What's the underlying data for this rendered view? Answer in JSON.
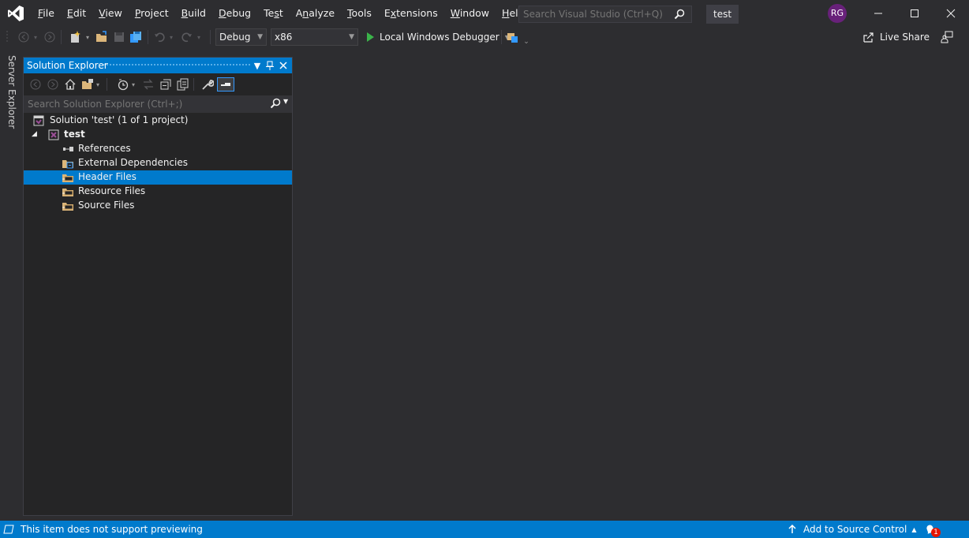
{
  "menu": {
    "items": [
      {
        "u": "F",
        "rest": "ile"
      },
      {
        "u": "E",
        "rest": "dit"
      },
      {
        "u": "V",
        "rest": "iew"
      },
      {
        "u": "P",
        "rest": "roject"
      },
      {
        "u": "B",
        "rest": "uild"
      },
      {
        "u": "D",
        "rest": "ebug"
      },
      {
        "u": "",
        "rest": "Te",
        "u2": "s",
        "rest2": "t"
      },
      {
        "u": "",
        "rest": "A",
        "u2": "n",
        "rest2": "alyze"
      },
      {
        "u": "T",
        "rest": "ools"
      },
      {
        "u": "",
        "rest": "E",
        "u2": "x",
        "rest2": "tensions"
      },
      {
        "u": "W",
        "rest": "indow"
      },
      {
        "u": "H",
        "rest": "elp"
      }
    ]
  },
  "title": {
    "search_placeholder": "Search Visual Studio (Ctrl+Q)",
    "solution_name": "test",
    "avatar_initials": "RG"
  },
  "toolbar": {
    "configuration": "Debug",
    "platform": "x86",
    "debugger": "Local Windows Debugger",
    "live_share": "Live Share"
  },
  "sidetab": {
    "label": "Server Explorer"
  },
  "solution_explorer": {
    "title": "Solution Explorer",
    "search_placeholder": "Search Solution Explorer (Ctrl+;)",
    "tree": {
      "solution": "Solution 'test' (1 of 1 project)",
      "project": "test",
      "items": [
        {
          "label": "References",
          "icon": "references-icon",
          "selected": false
        },
        {
          "label": "External Dependencies",
          "icon": "folder-dependencies-icon",
          "selected": false
        },
        {
          "label": "Header Files",
          "icon": "filter-folder-icon",
          "selected": true
        },
        {
          "label": "Resource Files",
          "icon": "filter-folder-icon",
          "selected": false
        },
        {
          "label": "Source Files",
          "icon": "filter-folder-icon",
          "selected": false
        }
      ]
    }
  },
  "statusbar": {
    "message": "This item does not support previewing",
    "source_control": "Add to Source Control",
    "notifications_count": "1"
  },
  "colors": {
    "accent": "#007acc",
    "background": "#2d2d30",
    "panel": "#252526",
    "vs_purple": "#68217a"
  }
}
